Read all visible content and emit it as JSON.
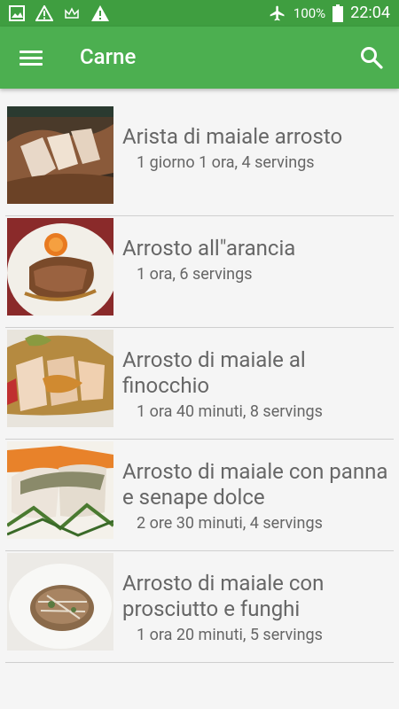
{
  "statusbar": {
    "battery": "100%",
    "time": "22:04"
  },
  "appbar": {
    "title": "Carne"
  },
  "recipes": [
    {
      "name": "Arista di maiale arrosto",
      "meta": "1 giorno 1 ora, 4 servings"
    },
    {
      "name": "Arrosto all\"arancia",
      "meta": "1 ora, 6 servings"
    },
    {
      "name": "Arrosto di maiale al finocchio",
      "meta": "1 ora 40 minuti, 8 servings"
    },
    {
      "name": "Arrosto di maiale con panna e senape dolce",
      "meta": "2 ore 30 minuti, 4 servings"
    },
    {
      "name": "Arrosto di maiale con prosciutto e funghi",
      "meta": "1 ora 20 minuti, 5 servings"
    }
  ]
}
